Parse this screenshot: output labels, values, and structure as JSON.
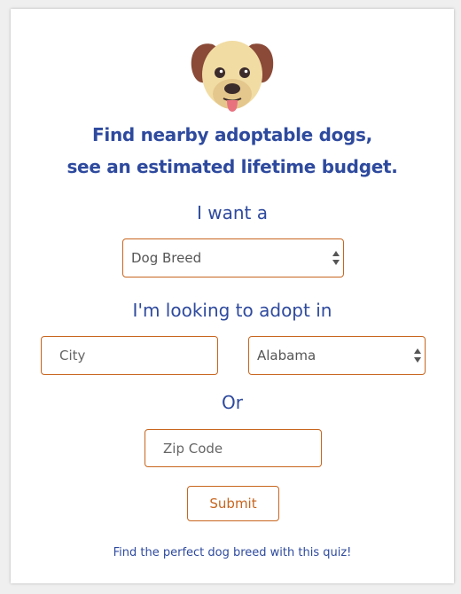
{
  "header": {
    "logo_icon": "dog-face-icon",
    "line1": "Find nearby adoptable dogs,",
    "line2": "see an estimated lifetime budget."
  },
  "form": {
    "want_label": "I want a",
    "breed_select": {
      "value": "Dog Breed"
    },
    "location_label": "I'm looking to adopt in",
    "city_input": {
      "placeholder": "City"
    },
    "state_select": {
      "value": "Alabama"
    },
    "or_label": "Or",
    "zip_input": {
      "placeholder": "Zip Code"
    },
    "submit_label": "Submit"
  },
  "footer": {
    "quiz_link": "Find the perfect dog breed with this quiz!"
  },
  "colors": {
    "primary_text": "#2e4a9e",
    "accent": "#c8651e"
  }
}
